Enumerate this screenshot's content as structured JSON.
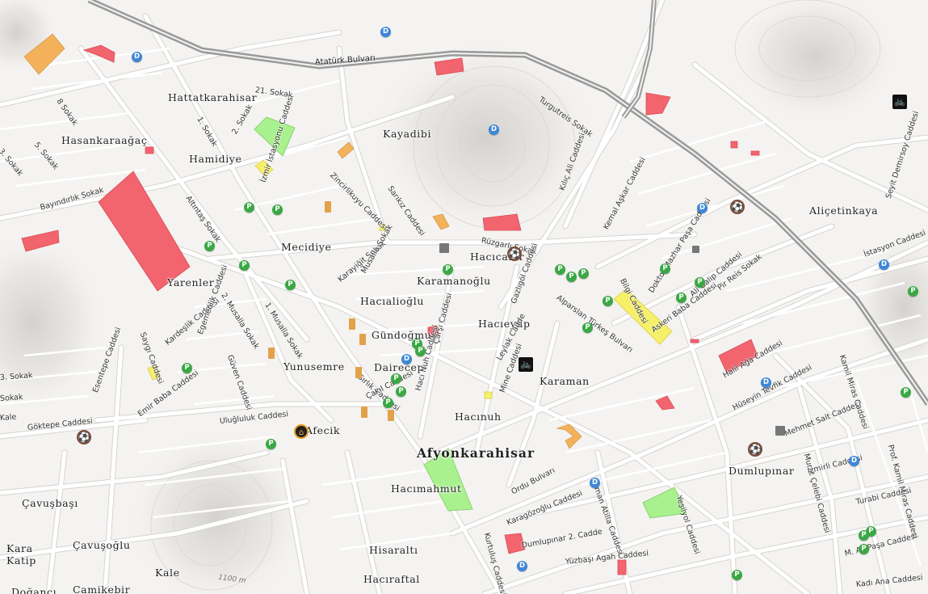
{
  "map": {
    "places": [
      {
        "name": "Afyonkarahisar",
        "major": true
      },
      {
        "name": "Hattatkarahisar"
      },
      {
        "name": "Hasankaraağaç"
      },
      {
        "name": "Hamidiye"
      },
      {
        "name": "Kayadibi"
      },
      {
        "name": "Mecidiye"
      },
      {
        "name": "Yarenler"
      },
      {
        "name": "Karamanoğlu"
      },
      {
        "name": "Hacıcafer"
      },
      {
        "name": "Hacıalioğlu"
      },
      {
        "name": "Hacıeyüp"
      },
      {
        "name": "Gündoğmuş"
      },
      {
        "name": "Yunusemre"
      },
      {
        "name": "Dairecep"
      },
      {
        "name": "Karaman"
      },
      {
        "name": "Hacınuh"
      },
      {
        "name": "Afecik"
      },
      {
        "name": "Hacımahmut"
      },
      {
        "name": "Çavuşbaşı"
      },
      {
        "name": "Çavuşoğlu"
      },
      {
        "name": "Kara Katip"
      },
      {
        "name": "Kale"
      },
      {
        "name": "Hisaraltı"
      },
      {
        "name": "Hacıraftal"
      },
      {
        "name": "Camikebir"
      },
      {
        "name": "Doğancı"
      },
      {
        "name": "Dumlupınar"
      },
      {
        "name": "Aliçetinkaya"
      }
    ],
    "streets": [
      "Atatürk Bulvarı",
      "21. Sokak",
      "1. Sokak",
      "2. Sokak",
      "8 Sokak",
      "5. Sokak",
      "3. Sokak",
      "Bayındırlık Sokak",
      "Altıntaş Sokak",
      "İzmir İstasyonu Caddesi",
      "Zincirlikuyu Caddesi",
      "Sarıkız Caddesi",
      "Turgutreis Sokak",
      "Kılıç Ali Caddesi",
      "Kemal Aşkar Caddesi",
      "Seyit Demirsoy Caddesi",
      "İstasyon Caddesi",
      "Rüzgarlı Sokak",
      "Doktor Mazhar Paşa Caddesi",
      "Ali Galip Caddesi",
      "Pir Reis Sokak",
      "Bilgi Caddesi",
      "Karayiğit Sokak",
      "Musalla Sokak",
      "1. Musalla Sokak",
      "2. Musalla Sokak",
      "Kardeşlik Caddesi",
      "Egemenlik Caddesi",
      "Güven Caddesi",
      "Saygı Caddesi",
      "Esentepe Caddesi",
      "Emir Baba Caddesi",
      "Göktepe Caddesi",
      "Uluğluluk Caddesi",
      "Gazlıgöl Caddesi",
      "Alparslan Türkeş Bulvarı",
      "Askeri Baba Caddesi",
      "Halil Ağa Caddesi",
      "Hüseyin Tevfik Caddesi",
      "Mehmet Sait Caddesi",
      "Kamil Miras Caddesi",
      "Murat Çelebi Caddesi",
      "İzmirli Caddesi",
      "Turabi Caddesi",
      "M. Ali Paşa Caddesi",
      "Prof. Kamil Miras Caddesi",
      "Kadı Ana Caddesi",
      "Yeşilyol Caddesi",
      "Ordu Bulvarı",
      "Karagözoğlu Caddesi",
      "Osman Atilla Caddesi",
      "Dumlupınar 2. Cadde",
      "Yüzbaşı Agah Caddesi",
      "Kurtuluş Caddesi",
      "Mine Caddesi",
      "Leylak Cadde",
      "Hacı Nuh Caddesi",
      "Çarşı Caddesi",
      "Sırlık Caddesi",
      "Çakıl Caddesi",
      "3. Sokak",
      "Sokak",
      "Kale"
    ],
    "contour_label": "1100 m",
    "colors": {
      "background": "#f4f3f1",
      "road": "#ffffff",
      "road_casing": "#d6d4d0",
      "railway": "#9a9a9a",
      "building_red": "#f2646e",
      "building_orange": "#f3b15c",
      "building_yellow": "#f5ef6a",
      "park": "#a9f18f",
      "poi_green": "#3aa844",
      "poi_blue": "#3e86d6"
    },
    "poi": {
      "parking_letter": "P",
      "blue_letter": "D"
    }
  }
}
